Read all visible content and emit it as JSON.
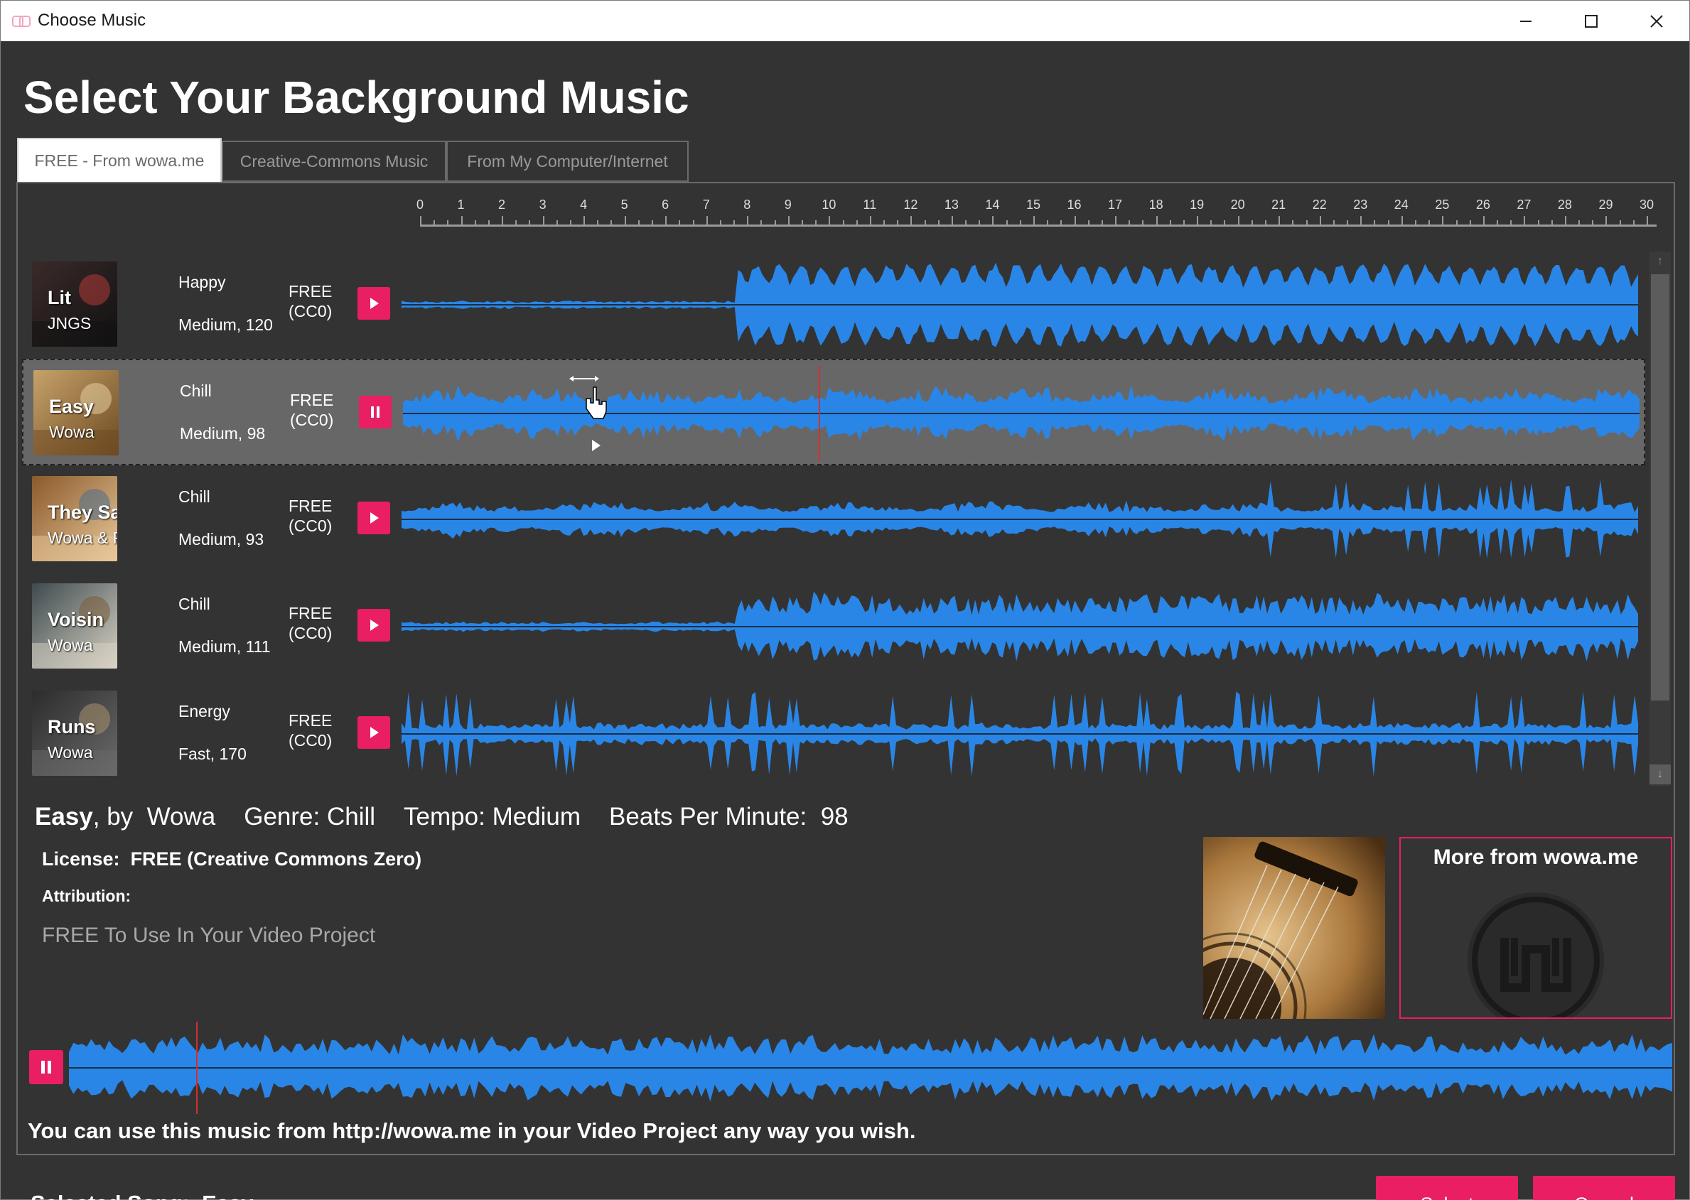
{
  "window": {
    "title": "Choose Music",
    "icons": [
      "app-icon",
      "minimize-icon",
      "maximize-icon",
      "close-icon"
    ]
  },
  "page": {
    "heading": "Select Your Background Music"
  },
  "tabs": [
    {
      "label": "FREE - From wowa.me",
      "active": true
    },
    {
      "label": "Creative-Commons Music",
      "active": false
    },
    {
      "label": "From My Computer/Internet",
      "active": false
    }
  ],
  "ruler": {
    "labels": [
      "0",
      "1",
      "2",
      "3",
      "4",
      "5",
      "6",
      "7",
      "8",
      "9",
      "10",
      "11",
      "12",
      "13",
      "14",
      "15",
      "16",
      "17",
      "18",
      "19",
      "20",
      "21",
      "22",
      "23",
      "24",
      "25",
      "26",
      "27",
      "28",
      "29",
      "30"
    ]
  },
  "tracks": [
    {
      "title": "Lit",
      "artist": "JNGS",
      "genre": "Happy",
      "tempo": "Medium, 120",
      "license": [
        "FREE",
        "(CC0)"
      ],
      "state": "play",
      "thumb_colors": [
        "#3a2a2a",
        "#111111",
        "#b33a3a"
      ]
    },
    {
      "title": "Easy",
      "artist": "Wowa",
      "genre": "Chill",
      "tempo": "Medium, 98",
      "license": [
        "FREE",
        "(CC0)"
      ],
      "state": "pause",
      "thumb_colors": [
        "#c7a26a",
        "#6d4a22",
        "#e6cfa0"
      ]
    },
    {
      "title": "They Say",
      "artist": "Wowa & Pipo",
      "genre": "Chill",
      "tempo": "Medium, 93",
      "license": [
        "FREE",
        "(CC0)"
      ],
      "state": "play",
      "thumb_colors": [
        "#8b5a2b",
        "#e8c79a",
        "#4a6d8c"
      ]
    },
    {
      "title": "Voisin",
      "artist": "Wowa",
      "genre": "Chill",
      "tempo": "Medium, 111",
      "license": [
        "FREE",
        "(CC0)"
      ],
      "state": "play",
      "thumb_colors": [
        "#3e4a4f",
        "#d8d2c4",
        "#7a5d3a"
      ]
    },
    {
      "title": "Runs",
      "artist": "Wowa",
      "genre": "Energy",
      "tempo": "Fast, 170",
      "license": [
        "FREE",
        "(CC0)"
      ],
      "state": "play",
      "thumb_colors": [
        "#2c2c2c",
        "#6a6a6a",
        "#a89270"
      ]
    }
  ],
  "details": {
    "title": "Easy",
    "by": ", by",
    "artist": "Wowa",
    "genre_label": "Genre:",
    "genre": "Chill",
    "tempo_label": "Tempo:",
    "tempo": "Medium",
    "bpm_label": "Beats Per Minute:",
    "bpm": "98",
    "license_label": "License:",
    "license": "FREE (Creative Commons Zero)",
    "attribution_label": "Attribution:",
    "attribution": "FREE To Use In Your Video Project",
    "more_label": "More from wowa.me",
    "usage": "You can use this music from http://wowa.me in your Video Project any way you wish."
  },
  "footer": {
    "selected_label": "Selected Song:",
    "selected_value": "Easy",
    "select_label": "Select",
    "cancel_label": "Cancel"
  },
  "colors": {
    "accent": "#e91e63",
    "wave": "#2a86e6",
    "playhead": "#d32f2f",
    "background": "#333333"
  }
}
